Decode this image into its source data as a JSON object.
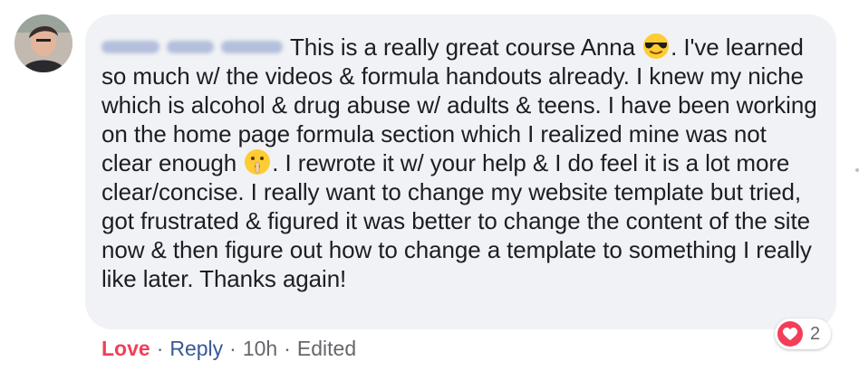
{
  "comment": {
    "body": "This is a really great course Anna",
    "body_part2": ". I've learned so much w/ the videos & formula handouts already. I knew my niche which is alcohol & drug abuse w/ adults & teens. I have been working on the home page formula section which I realized mine was not clear enough",
    "body_part3": ". I rewrote it w/ your help & I do feel it is a lot more clear/concise. I really want to change my website template but tried, got frustrated & figured it was better to change the content of the site now & then figure out how to change a template to something I really like later. Thanks again!",
    "emoji_1": "smiling-face-with-sunglasses",
    "emoji_2": "shushing-face"
  },
  "reactions": {
    "icon": "heart",
    "count": "2"
  },
  "actions": {
    "love_label": "Love",
    "reply_label": "Reply",
    "time": "10h",
    "edited_label": "Edited",
    "separator": "·"
  },
  "colors": {
    "bubble_bg": "#f0f2f5",
    "love": "#f33e58",
    "reply_link": "#385898",
    "meta_text": "#65676b"
  }
}
